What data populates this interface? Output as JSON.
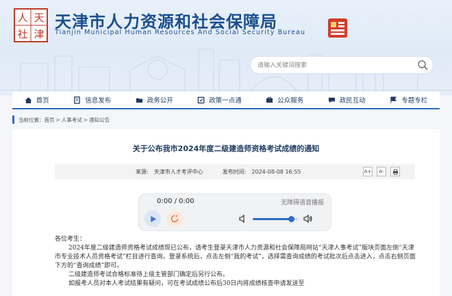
{
  "header": {
    "logo_chars": [
      "人",
      "天",
      "社",
      "津"
    ],
    "title": "天津市人力资源和社会保障局",
    "subtitle": "Tianjin Municipal Human Resources And Social Security Bureau",
    "search_placeholder": "请输入关键词搜索"
  },
  "nav": {
    "items": [
      {
        "label": "首页",
        "icon": "home-icon"
      },
      {
        "label": "信息发布",
        "icon": "document-icon"
      },
      {
        "label": "政务公开",
        "icon": "folder-icon"
      },
      {
        "label": "政策一点通",
        "icon": "policy-icon"
      },
      {
        "label": "公众服务",
        "icon": "service-icon"
      },
      {
        "label": "政民互动",
        "icon": "chat-icon"
      },
      {
        "label": "专题专栏",
        "icon": "topic-icon"
      }
    ],
    "accent": "#2b6cc4"
  },
  "breadcrumb": {
    "label": "当前位置：",
    "items": [
      "首页",
      "人事考试",
      "通知公告"
    ]
  },
  "article": {
    "title": "关于公布我市2024年度二级建造师资格考试成绩的通知",
    "source_label": "来源:",
    "source": "天津市人才考评中心",
    "time_label": "发布时间:",
    "time": "2024-08-08 16:55",
    "buttons": [
      "A+",
      "A-",
      "print"
    ]
  },
  "player": {
    "time": "0:00 / 0:00",
    "tts_label": "无障碍语音播报",
    "volume": 0.85
  },
  "body": {
    "greeting": "各位考生：",
    "para1": "2024年度二级建造师资格考试成绩现已公布，请考生登录天津市人力资源和社会保障局网站“天津人事考试”版块页面左侧“天津市专业技术人员资格考试”栏目进行查询。登录系统后，点击左侧“我的考试”，选择需查询成绩的考试批次后点击进入，点击右侧页面下方的“查询成绩”即可。",
    "para2": "二级建造师考试合格标准待上级主管部门确定后另行公布。",
    "para3": "如报考人员对本人考试结果有疑问，可在考试成绩公布后30日内将成绩核查申请发送至"
  }
}
